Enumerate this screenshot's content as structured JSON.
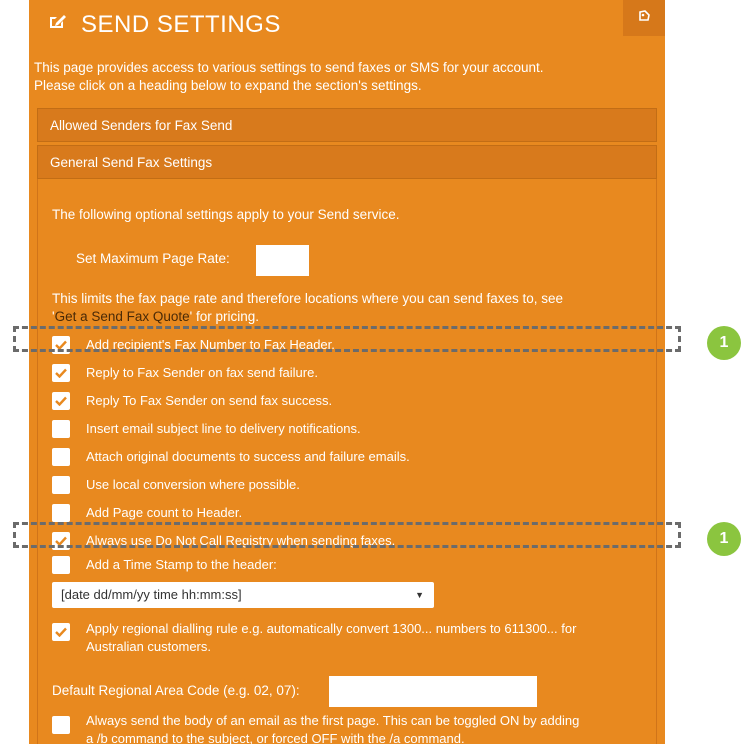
{
  "header": {
    "title": "SEND SETTINGS",
    "title_icon": "edit-icon",
    "tool_icon": "pin-icon"
  },
  "intro": {
    "line1": "This page provides access to various settings to send faxes or SMS for your account.",
    "line2": "Please click on a heading below to expand the section's settings."
  },
  "sections": {
    "allowed_senders": "Allowed Senders for Fax Send",
    "general": "General Send Fax Settings"
  },
  "general": {
    "description": "The following optional settings apply to your Send service.",
    "max_rate_label": "Set Maximum Page Rate:",
    "max_rate_value": "",
    "limit_text_1": "This limits the fax page rate and therefore locations where you can send faxes to, see",
    "limit_quote_open": "'",
    "limit_link": "Get a Send Fax Quote",
    "limit_text_2": "' for pricing."
  },
  "options": [
    {
      "label": "Add recipient's Fax Number to Fax Header.",
      "checked": true
    },
    {
      "label": "Reply to Fax Sender on fax send failure.",
      "checked": true
    },
    {
      "label": "Reply To Fax Sender on send fax success.",
      "checked": true
    },
    {
      "label": "Insert email subject line to delivery notifications.",
      "checked": false
    },
    {
      "label": "Attach original documents to success and failure emails.",
      "checked": false
    },
    {
      "label": "Use local conversion where possible.",
      "checked": false
    },
    {
      "label": "Add Page count to Header.",
      "checked": false
    },
    {
      "label": "Always use Do Not Call Registry when sending faxes.",
      "checked": true
    },
    {
      "label": "Add a Time Stamp to the header:",
      "checked": false
    }
  ],
  "timestamp_format": {
    "selected": "[date dd/mm/yy time hh:mm:ss]"
  },
  "regional_rule": {
    "line1": "Apply regional dialling rule e.g. automatically convert 1300... numbers to 611300... for",
    "line2": "Australian customers.",
    "checked": true
  },
  "area_code": {
    "label": "Default Regional Area Code (e.g. 02, 07):",
    "value": ""
  },
  "email_body": {
    "line1": "Always send the body of an email as the first page. This can be toggled ON by adding",
    "line2": "a /b command to the subject, or forced OFF with the /a command.",
    "checked": false
  },
  "annotations": {
    "badge_1": "1",
    "badge_2": "1"
  },
  "colors": {
    "panel": "#e8891f",
    "section_header": "#d87a1c",
    "checkmark": "#e8891f",
    "badge": "#8bc53f",
    "link": "#4a2a07"
  }
}
